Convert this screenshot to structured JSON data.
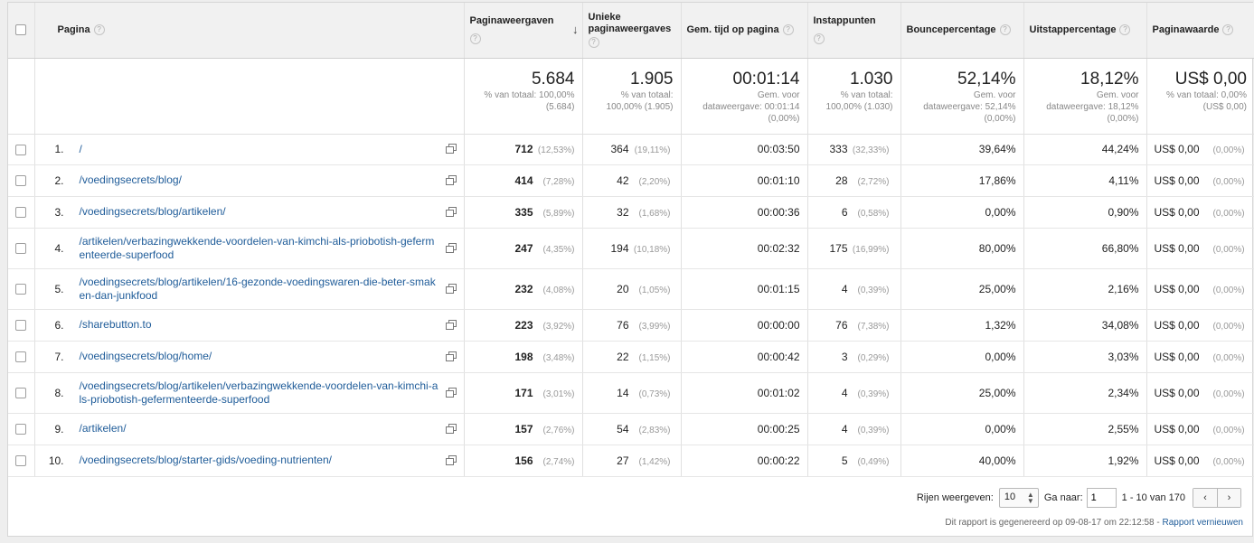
{
  "columns": {
    "page": "Pagina",
    "pageviews": "Paginaweergaven",
    "unique": "Unieke paginaweergaves",
    "avg_time": "Gem. tijd op pagina",
    "entrances": "Instappunten",
    "bounce": "Bouncepercentage",
    "exit": "Uitstappercentage",
    "value": "Paginawaarde"
  },
  "help_glyph": "?",
  "sort_glyph": "↓",
  "totals": {
    "pageviews": {
      "big": "5.684",
      "l1": "% van totaal: 100,00%",
      "l2": "(5.684)"
    },
    "unique": {
      "big": "1.905",
      "l1": "% van totaal:",
      "l2": "100,00% (1.905)"
    },
    "avg_time": {
      "big": "00:01:14",
      "l1": "Gem. voor",
      "l2": "dataweergave: 00:01:14",
      "l3": "(0,00%)"
    },
    "entrances": {
      "big": "1.030",
      "l1": "% van totaal:",
      "l2": "100,00% (1.030)"
    },
    "bounce": {
      "big": "52,14%",
      "l1": "Gem. voor",
      "l2": "dataweergave: 52,14%",
      "l3": "(0,00%)"
    },
    "exit": {
      "big": "18,12%",
      "l1": "Gem. voor",
      "l2": "dataweergave: 18,12%",
      "l3": "(0,00%)"
    },
    "value": {
      "big": "US$ 0,00",
      "l1": "% van totaal: 0,00%",
      "l2": "(US$ 0,00)"
    }
  },
  "rows": [
    {
      "idx": "1.",
      "path": "/",
      "pv": "712",
      "pv_pct": "(12,53%)",
      "uq": "364",
      "uq_pct": "(19,11%)",
      "time": "00:03:50",
      "ent": "333",
      "ent_pct": "(32,33%)",
      "bounce": "39,64%",
      "exit": "44,24%",
      "val": "US$ 0,00",
      "val_pct": "(0,00%)"
    },
    {
      "idx": "2.",
      "path": "/voedingsecrets/blog/",
      "pv": "414",
      "pv_pct": "(7,28%)",
      "uq": "42",
      "uq_pct": "(2,20%)",
      "time": "00:01:10",
      "ent": "28",
      "ent_pct": "(2,72%)",
      "bounce": "17,86%",
      "exit": "4,11%",
      "val": "US$ 0,00",
      "val_pct": "(0,00%)"
    },
    {
      "idx": "3.",
      "path": "/voedingsecrets/blog/artikelen/",
      "pv": "335",
      "pv_pct": "(5,89%)",
      "uq": "32",
      "uq_pct": "(1,68%)",
      "time": "00:00:36",
      "ent": "6",
      "ent_pct": "(0,58%)",
      "bounce": "0,00%",
      "exit": "0,90%",
      "val": "US$ 0,00",
      "val_pct": "(0,00%)"
    },
    {
      "idx": "4.",
      "path": "/artikelen/verbazingwekkende-voordelen-van-kimchi-als-priobotish-gefermenteerde-superfood",
      "pv": "247",
      "pv_pct": "(4,35%)",
      "uq": "194",
      "uq_pct": "(10,18%)",
      "time": "00:02:32",
      "ent": "175",
      "ent_pct": "(16,99%)",
      "bounce": "80,00%",
      "exit": "66,80%",
      "val": "US$ 0,00",
      "val_pct": "(0,00%)"
    },
    {
      "idx": "5.",
      "path": "/voedingsecrets/blog/artikelen/16-gezonde-voedingswaren-die-beter-smaken-dan-junkfood",
      "pv": "232",
      "pv_pct": "(4,08%)",
      "uq": "20",
      "uq_pct": "(1,05%)",
      "time": "00:01:15",
      "ent": "4",
      "ent_pct": "(0,39%)",
      "bounce": "25,00%",
      "exit": "2,16%",
      "val": "US$ 0,00",
      "val_pct": "(0,00%)"
    },
    {
      "idx": "6.",
      "path": "/sharebutton.to",
      "pv": "223",
      "pv_pct": "(3,92%)",
      "uq": "76",
      "uq_pct": "(3,99%)",
      "time": "00:00:00",
      "ent": "76",
      "ent_pct": "(7,38%)",
      "bounce": "1,32%",
      "exit": "34,08%",
      "val": "US$ 0,00",
      "val_pct": "(0,00%)"
    },
    {
      "idx": "7.",
      "path": "/voedingsecrets/blog/home/",
      "pv": "198",
      "pv_pct": "(3,48%)",
      "uq": "22",
      "uq_pct": "(1,15%)",
      "time": "00:00:42",
      "ent": "3",
      "ent_pct": "(0,29%)",
      "bounce": "0,00%",
      "exit": "3,03%",
      "val": "US$ 0,00",
      "val_pct": "(0,00%)"
    },
    {
      "idx": "8.",
      "path": "/voedingsecrets/blog/artikelen/verbazingwekkende-voordelen-van-kimchi-als-priobotish-gefermenteerde-superfood",
      "pv": "171",
      "pv_pct": "(3,01%)",
      "uq": "14",
      "uq_pct": "(0,73%)",
      "time": "00:01:02",
      "ent": "4",
      "ent_pct": "(0,39%)",
      "bounce": "25,00%",
      "exit": "2,34%",
      "val": "US$ 0,00",
      "val_pct": "(0,00%)"
    },
    {
      "idx": "9.",
      "path": "/artikelen/",
      "pv": "157",
      "pv_pct": "(2,76%)",
      "uq": "54",
      "uq_pct": "(2,83%)",
      "time": "00:00:25",
      "ent": "4",
      "ent_pct": "(0,39%)",
      "bounce": "0,00%",
      "exit": "2,55%",
      "val": "US$ 0,00",
      "val_pct": "(0,00%)"
    },
    {
      "idx": "10.",
      "path": "/voedingsecrets/blog/starter-gids/voeding-nutrienten/",
      "pv": "156",
      "pv_pct": "(2,74%)",
      "uq": "27",
      "uq_pct": "(1,42%)",
      "time": "00:00:22",
      "ent": "5",
      "ent_pct": "(0,49%)",
      "bounce": "40,00%",
      "exit": "1,92%",
      "val": "US$ 0,00",
      "val_pct": "(0,00%)"
    }
  ],
  "footer": {
    "rows_label": "Rijen weergeven:",
    "rows_value": "10",
    "goto_label": "Ga naar:",
    "goto_value": "1",
    "range": "1 - 10 van 170",
    "prev": "‹",
    "next": "›",
    "generated": "Dit rapport is gegenereerd op 09-08-17 om 22:12:58 - ",
    "refresh": "Rapport vernieuwen"
  }
}
